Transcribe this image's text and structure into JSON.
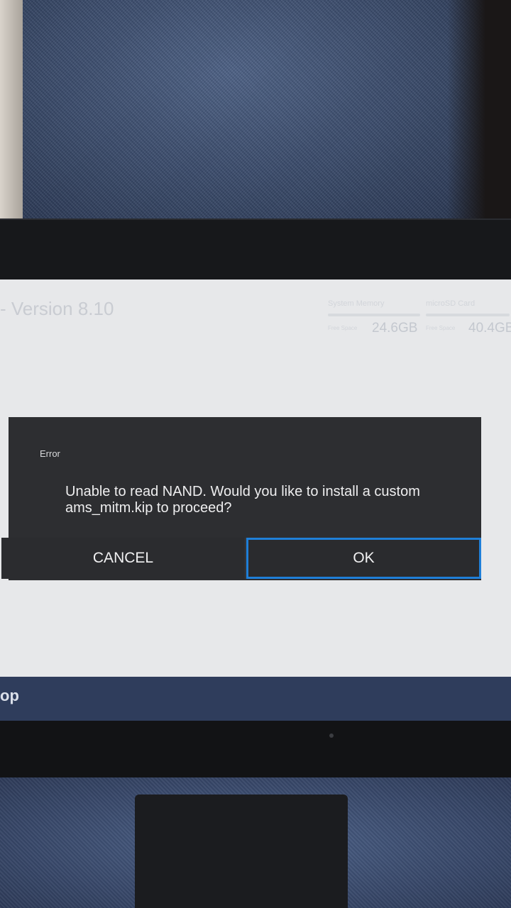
{
  "screen": {
    "version_label": "- Version 8.10",
    "storage": {
      "system": {
        "label": "System Memory",
        "free_label": "Free Space",
        "value": "24.6GB"
      },
      "sd": {
        "label": "microSD Card",
        "free_label": "Free Space",
        "value": "40.4GB"
      }
    },
    "bottom_label": "op"
  },
  "dialog": {
    "title": "Error",
    "message": "Unable to read NAND.  Would you like to install a custom ams_mitm.kip to proceed?",
    "cancel_label": "CANCEL",
    "ok_label": "OK"
  },
  "colors": {
    "dialog_background": "#2d2e31",
    "focus_outline": "#1f7fd8",
    "screen_background": "#e7e8ea"
  }
}
